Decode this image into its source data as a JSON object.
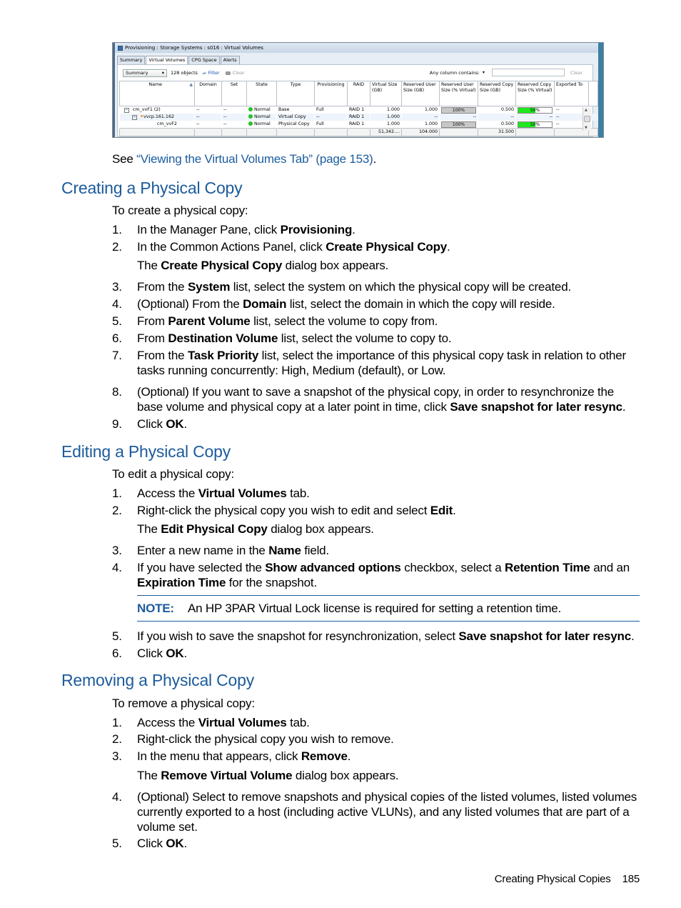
{
  "screenshot": {
    "window_title": "Provisioning : Storage Systems : s016 : Virtual Volumes",
    "tabs": [
      {
        "label": "Summary",
        "active": false
      },
      {
        "label": "Virtual Volumes",
        "active": true
      },
      {
        "label": "CPG Space",
        "active": false
      },
      {
        "label": "Alerts",
        "active": false
      }
    ],
    "toolbar": {
      "view_select": "Summary",
      "object_count": "128 objects",
      "filter_label": "Filter",
      "clear_label": "Clear",
      "any_column_label": "Any column contains:",
      "search_value": "",
      "search_clear_label": "Clear"
    },
    "columns": [
      "Name",
      "Domain",
      "Set",
      "State",
      "Type",
      "Provisioning",
      "RAID",
      "Virtual Size (GB)",
      "Reserved User Size (GB)",
      "Reserved User Size (% Virtual)",
      "Reserved Copy Size (GB)",
      "Reserved Copy Size (% Virtual)",
      "Exported To"
    ],
    "rows": [
      {
        "name": "cm_vvF1  (2)",
        "level": 0,
        "toggle": "⊟",
        "domain": "--",
        "set": "--",
        "state": "Normal",
        "type": "Base",
        "provisioning": "Full",
        "raid": "RAID 1",
        "virtual_size": "1.000",
        "reserved_user": "1.000",
        "reserved_user_pct": "100%",
        "reserved_user_pct_value": 100,
        "reserved_copy": "0.500",
        "reserved_copy_pct": "50%",
        "reserved_copy_pct_value": 50,
        "exported_to": "--"
      },
      {
        "name": "vvcp.161.162",
        "level": 1,
        "toggle": "⊟",
        "domain": "--",
        "set": "--",
        "state": "Normal",
        "type": "Virtual Copy",
        "provisioning": "--",
        "raid": "RAID 1",
        "virtual_size": "1.000",
        "reserved_user": "--",
        "reserved_user_pct": "--",
        "reserved_copy": "--",
        "reserved_copy_pct": "--",
        "exported_to": "--"
      },
      {
        "name": "cm_vvF2",
        "level": 2,
        "toggle": "",
        "domain": "--",
        "set": "--",
        "state": "Normal",
        "type": "Physical Copy",
        "provisioning": "Full",
        "raid": "RAID 1",
        "virtual_size": "1.000",
        "reserved_user": "1.000",
        "reserved_user_pct": "100%",
        "reserved_user_pct_value": 100,
        "reserved_copy": "0.500",
        "reserved_copy_pct": "50%",
        "reserved_copy_pct_value": 50,
        "exported_to": "--"
      }
    ],
    "totals": {
      "virtual_size": "51,342....",
      "reserved_user": "104.000",
      "reserved_copy": "31.500"
    },
    "colors": {
      "state_normal": "#22c322",
      "bar_green": "#1ee81e",
      "bar_grey": "#c8c8c8"
    }
  },
  "see_also": {
    "prefix": "See ",
    "link": "“Viewing the Virtual Volumes Tab” (page 153)",
    "suffix": "."
  },
  "sections": {
    "create": {
      "title": "Creating a Physical Copy",
      "intro": "To create a physical copy:",
      "steps": [
        {
          "num": "1.",
          "parts": [
            "In the Manager Pane, click ",
            "Provisioning",
            "."
          ]
        },
        {
          "num": "2.",
          "parts": [
            "In the Common Actions Panel, click ",
            "Create Physical Copy",
            "."
          ]
        },
        {
          "num": "3.",
          "parts": [
            "From the ",
            "System",
            " list, select the system on which the physical copy will be created."
          ]
        },
        {
          "num": "4.",
          "parts": [
            "(Optional) From the ",
            "Domain",
            " list, select the domain in which the copy will reside."
          ]
        },
        {
          "num": "5.",
          "parts": [
            "From ",
            "Parent Volume",
            " list, select the volume to copy from."
          ]
        },
        {
          "num": "6.",
          "parts": [
            "From ",
            "Destination Volume",
            " list, select the volume to copy to."
          ]
        },
        {
          "num": "7.",
          "parts": [
            "From the ",
            "Task Priority",
            " list, select the importance of this physical copy task in relation to other tasks running concurrently: High, Medium (default), or Low."
          ]
        },
        {
          "num": "8.",
          "parts": [
            "(Optional) If you want to save a snapshot of the physical copy, in order to resynchronize the base volume and physical copy at a later point in time, click ",
            "Save snapshot for later resync",
            "."
          ]
        },
        {
          "num": "9.",
          "parts": [
            "Click ",
            "OK",
            "."
          ]
        }
      ],
      "result": [
        "The ",
        "Create Physical Copy",
        " dialog box appears."
      ]
    },
    "edit": {
      "title": "Editing a Physical Copy",
      "intro": "To edit a physical copy:",
      "steps": [
        {
          "num": "1.",
          "parts": [
            "Access the ",
            "Virtual Volumes",
            " tab."
          ]
        },
        {
          "num": "2.",
          "parts": [
            "Right-click the physical copy you wish to edit and select ",
            "Edit",
            "."
          ]
        },
        {
          "num": "3.",
          "parts": [
            "Enter a new name in the ",
            "Name",
            " field."
          ]
        },
        {
          "num": "4.",
          "parts": [
            "If you have selected the ",
            "Show advanced options",
            " checkbox, select a ",
            "Retention Time",
            " and an ",
            "Expiration Time",
            " for the snapshot."
          ]
        },
        {
          "num": "5.",
          "parts": [
            "If you wish to save the snapshot for resynchronization, select ",
            "Save snapshot for later resync",
            "."
          ]
        },
        {
          "num": "6.",
          "parts": [
            "Click ",
            "OK",
            "."
          ]
        }
      ],
      "result": [
        "The ",
        "Edit Physical Copy",
        " dialog box appears."
      ],
      "note": {
        "label": "NOTE:",
        "text": "An HP 3PAR Virtual Lock license is required for setting a retention time."
      }
    },
    "remove": {
      "title": "Removing a Physical Copy",
      "intro": "To remove a physical copy:",
      "steps": [
        {
          "num": "1.",
          "parts": [
            "Access the ",
            "Virtual Volumes",
            " tab."
          ]
        },
        {
          "num": "2.",
          "parts": [
            "Right-click the physical copy you wish to remove."
          ]
        },
        {
          "num": "3.",
          "parts": [
            "In the menu that appears, click ",
            "Remove",
            "."
          ]
        },
        {
          "num": "4.",
          "parts": [
            "(Optional) Select to remove snapshots and physical copies of the listed volumes, listed volumes currently exported to a host (including active VLUNs), and any listed volumes that are part of a volume set."
          ]
        },
        {
          "num": "5.",
          "parts": [
            "Click ",
            "OK",
            "."
          ]
        }
      ],
      "result": [
        "The ",
        "Remove Virtual Volume",
        " dialog box appears."
      ]
    }
  },
  "footer": {
    "section": "Creating Physical Copies",
    "page": "185"
  },
  "colors": {
    "heading": "#1c5b9c",
    "link": "#1b5d9e"
  }
}
